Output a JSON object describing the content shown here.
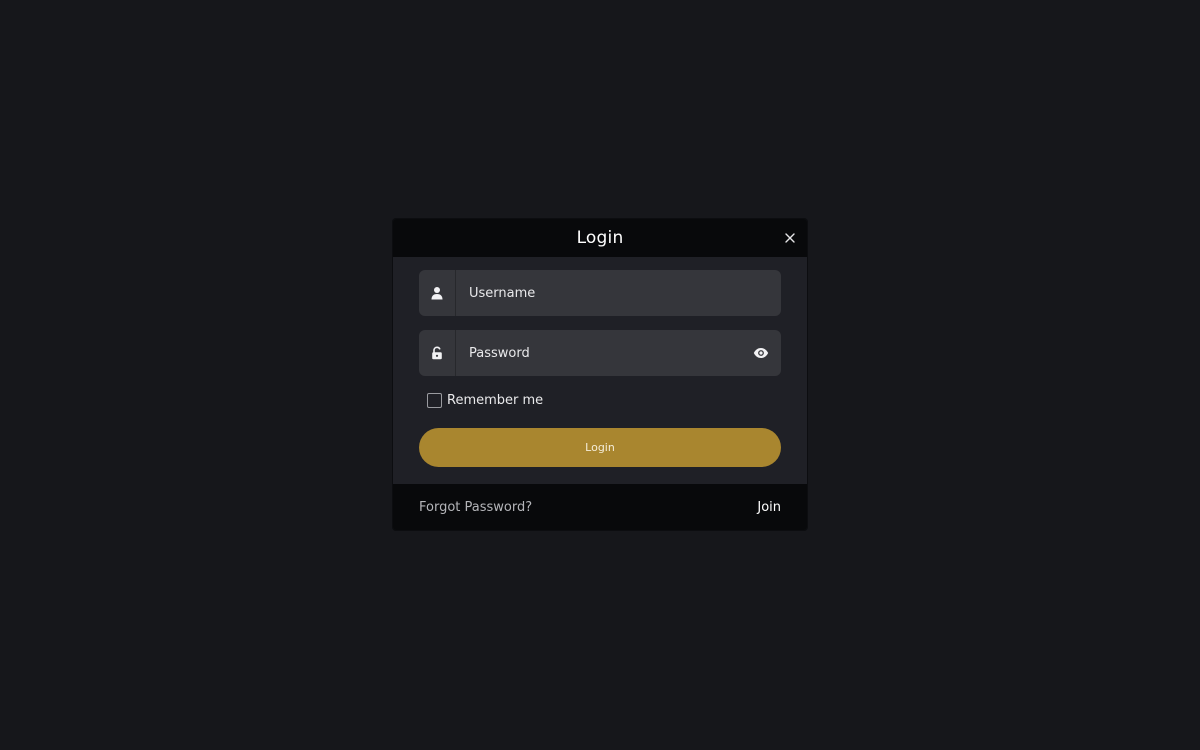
{
  "modal": {
    "title": "Login",
    "close_icon": "close-icon"
  },
  "form": {
    "username": {
      "placeholder": "Username",
      "value": "",
      "icon": "user-icon"
    },
    "password": {
      "placeholder": "Password",
      "value": "",
      "icon": "lock-icon",
      "toggle_icon": "eye-icon"
    },
    "remember": {
      "label": "Remember me",
      "checked": false
    },
    "submit_label": "Login"
  },
  "footer": {
    "forgot_label": "Forgot Password?",
    "join_label": "Join"
  },
  "colors": {
    "background": "#16171b",
    "modal": "#1f2026",
    "header": "#08090b",
    "field": "#35363b",
    "accent": "#a9862f"
  }
}
